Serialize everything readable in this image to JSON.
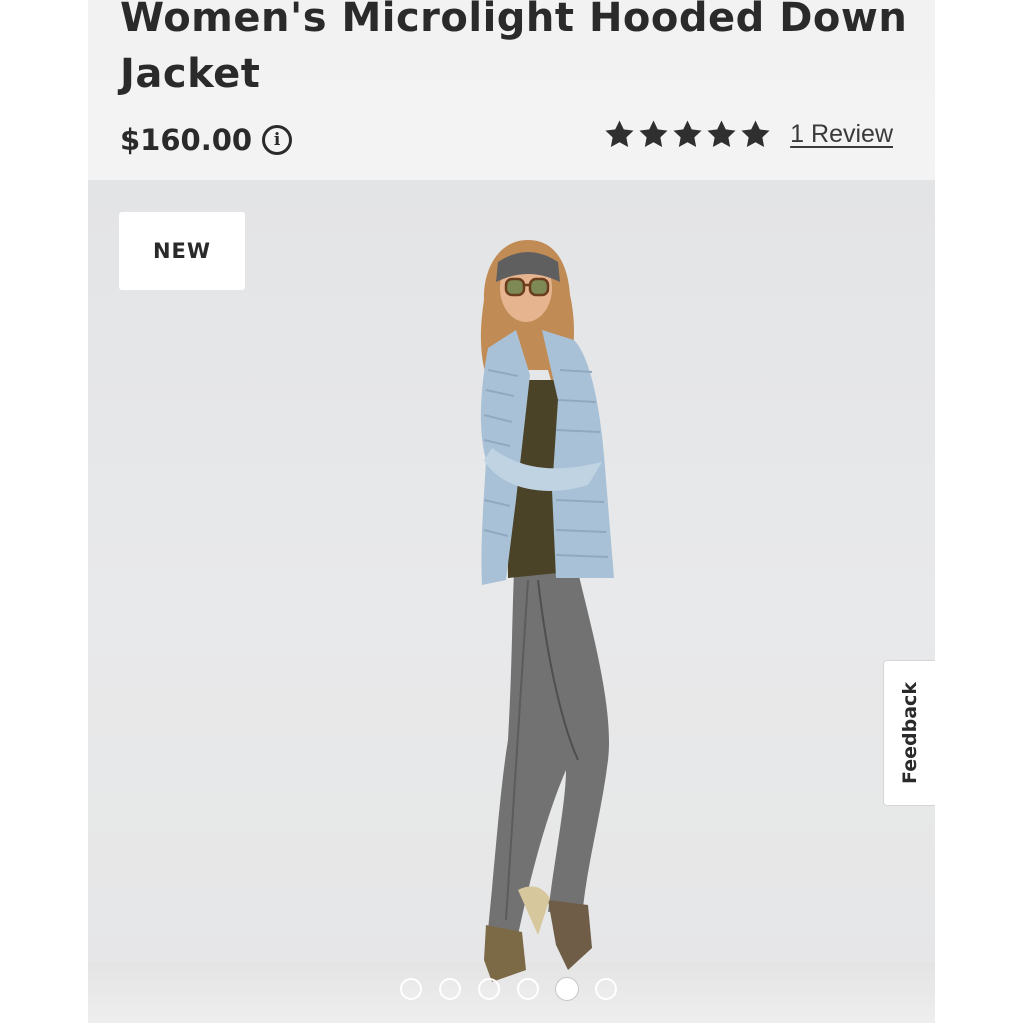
{
  "product": {
    "title": "Women's Microlight Hooded Down Jacket",
    "price": "$160.00",
    "rating": 5,
    "rating_max": 5,
    "review_link": "1 Review",
    "badge": "NEW"
  },
  "gallery": {
    "slide_count": 6,
    "active_slide": 5
  },
  "feedback": {
    "label": "Feedback"
  },
  "colors": {
    "text": "#2a2a2a",
    "star": "#2f2f2f",
    "background": "#e6e7e8",
    "jacket": "#a9c1d6",
    "pants": "#727272",
    "top": "#4a4328"
  },
  "icons": {
    "info": "info-circle-icon",
    "star": "star-icon"
  }
}
